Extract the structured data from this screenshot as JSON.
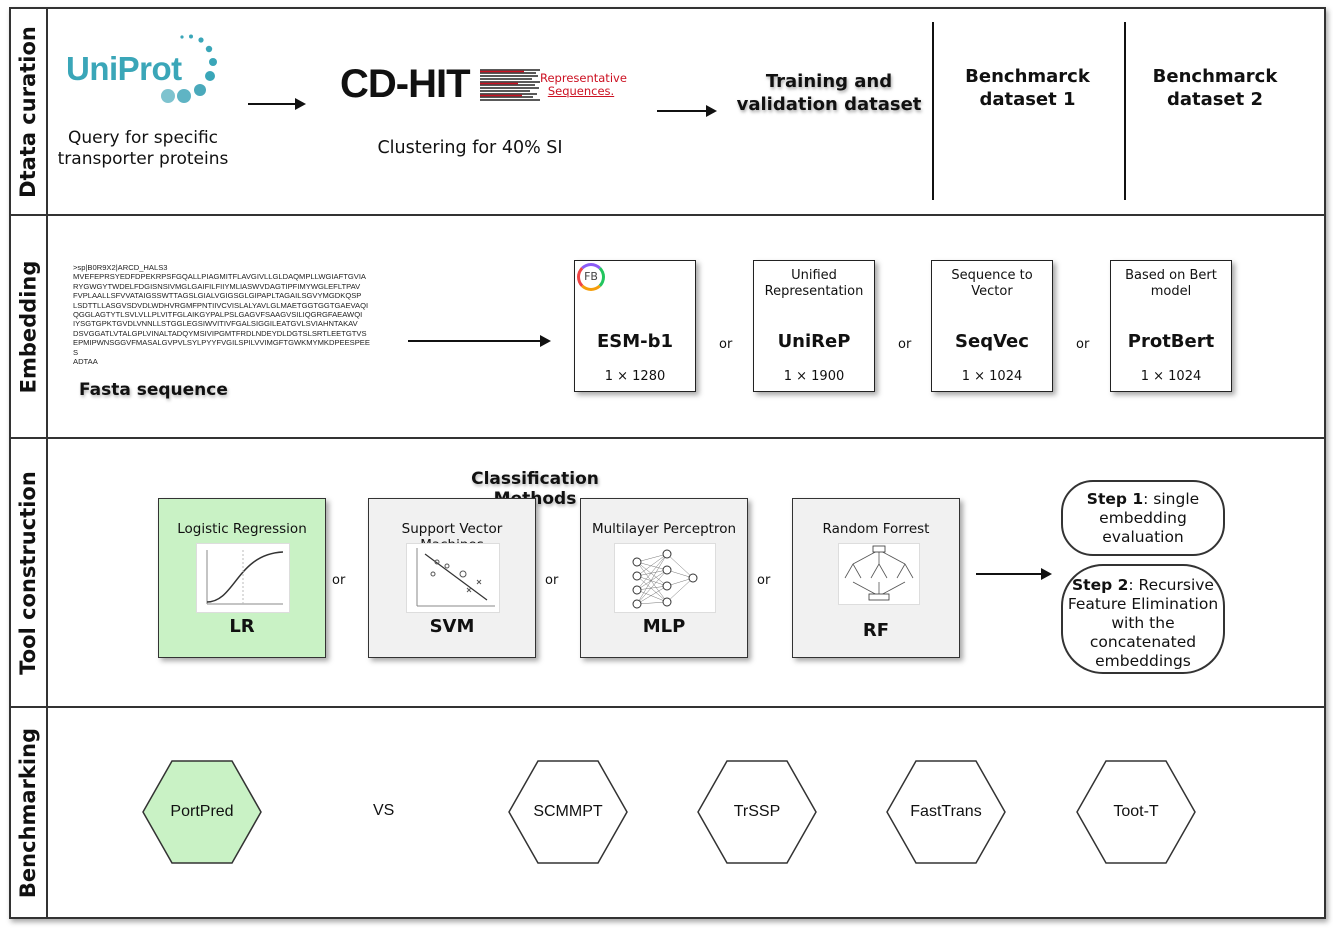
{
  "rows": [
    {
      "label": "Dtata curation"
    },
    {
      "label": "Embedding"
    },
    {
      "label": "Tool construction"
    },
    {
      "label": "Benchmarking"
    }
  ],
  "curation": {
    "uniprot_logo": "UniProt",
    "uniprot_caption": [
      "Query for specific",
      "transporter proteins"
    ],
    "cdhit_logo": "CD-HIT",
    "cdhit_tag": [
      "Representative",
      "Sequences."
    ],
    "cdhit_caption": "Clustering for 40% SI",
    "training": [
      "Training and",
      "validation dataset"
    ],
    "bench1": [
      "Benchmarck",
      "dataset 1"
    ],
    "bench2": [
      "Benchmarck",
      "dataset 2"
    ]
  },
  "embedding": {
    "fasta_header": ">sp|B0R9X2|ARCD_HALS3",
    "fasta_lines": [
      "MVEFEPRSYEDFDPEKRPSFGQALLPIAGMITFLAVGIVLLGLDAQMPLLWGIAFTGVIA",
      "RYGWGYTWDELFDGISNSIVMGLGAIFILFIIYMLIASWVDAGTIPFIMYWGLEFLTPAV",
      "FVPLAALLSFVVATAIGSSWTTAGSLGIALVGIGSGLGIPAPLTAGAILSGVYMGDKQSP",
      "LSDTTLLASGVSDVDLWDHVRGMFPNTIIVCVISLALYAVLGLMAETGGTGGTGAEVAQI",
      "QGGLAGTYTLSVLVLLPLVITFGLAIKGYPALPSLGAGVFSAAGVSILIQGRGFAEAWQI",
      "IYSGTGPKTGVDLVNNLLSTGGLEGSIWVITIVFGALSIGGILEATGVLSVIAHNTAKAV",
      "DSVGGATLVTALGPLVINALTADQYMSIVIPGMTFRDLNDEYDLDGTSLSRTLEETGTVS",
      "EPMIPWNSGGVFMASALGVPVLSYLPYYFVGILSPILVVIMGFTGWKMYMKDPEESPEES",
      "ADTAA"
    ],
    "fasta_label": "Fasta sequence",
    "fb_icon": "FB",
    "models": [
      {
        "desc": "",
        "name": "ESM-b1",
        "dim": "1 × 1280"
      },
      {
        "desc": "Unified Representation",
        "name": "UniReP",
        "dim": "1 × 1900"
      },
      {
        "desc": "Sequence to Vector",
        "name": "SeqVec",
        "dim": "1 × 1024"
      },
      {
        "desc": "Based on Bert model",
        "name": "ProtBert",
        "dim": "1 × 1024"
      }
    ],
    "or_label": "or"
  },
  "tool": {
    "title": "Classification Methods",
    "methods": [
      {
        "name": "Logistic Regression",
        "abbr": "LR"
      },
      {
        "name": "Support Vector Machines",
        "abbr": "SVM"
      },
      {
        "name": "Multilayer Perceptron",
        "abbr": "MLP"
      },
      {
        "name": "Random Forrest",
        "abbr": "RF"
      }
    ],
    "or_label": "or",
    "step1_bold": "Step 1",
    "step1_rest": ": single embedding evaluation",
    "step2_bold": "Step 2",
    "step2_rest": ": Recursive Feature Elimination with the concatenated embeddings"
  },
  "bench": {
    "main": "PortPred",
    "vs": "VS",
    "others": [
      "SCMMPT",
      "TrSSP",
      "FastTrans",
      "Toot-T"
    ]
  },
  "colors": {
    "highlight": "#c9f2c5",
    "uniprot_teal": "#3aa6b8",
    "cdhit_red": "#cc1122"
  }
}
